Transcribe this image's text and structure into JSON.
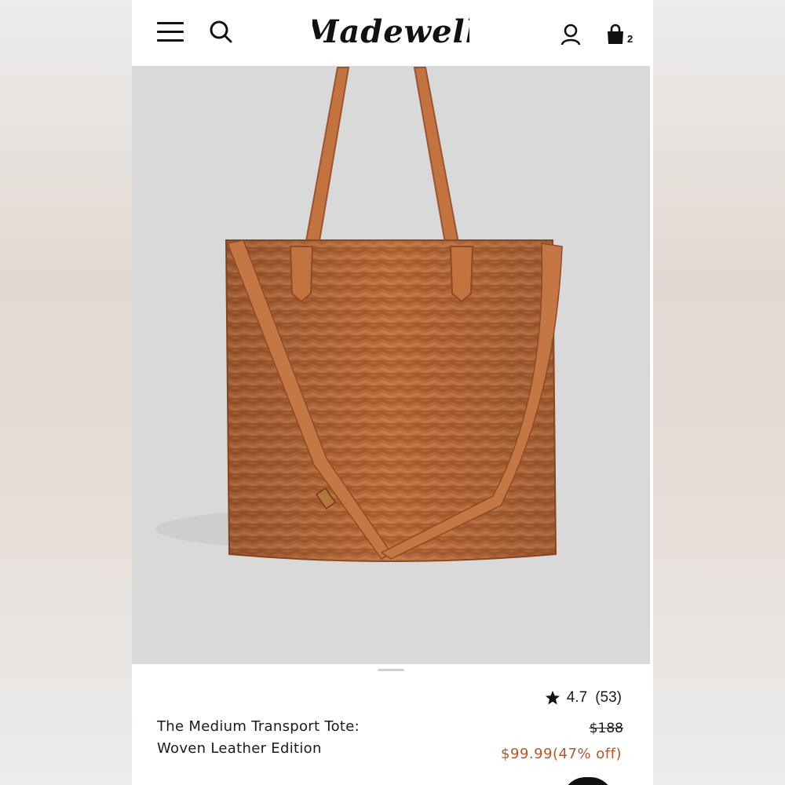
{
  "header": {
    "brand": "Madewell",
    "bag_count": "2"
  },
  "icons": {
    "menu": "hamburger-menu-icon",
    "search": "search-icon",
    "account": "user-icon",
    "bag": "shopping-bag-icon",
    "rating": "star-icon"
  },
  "product": {
    "image_alt": "Woven leather tote bag",
    "name_line1": "The Medium Transport Tote:",
    "name_line2": "Woven Leather Edition",
    "rating": "4.7",
    "review_count": "(53)",
    "original_price": "$188",
    "sale_price": "$99.99(47% off)"
  },
  "colors": {
    "sale": "#b5552c",
    "image_bg": "#d9d9d9",
    "leather": "#b86a3a"
  }
}
